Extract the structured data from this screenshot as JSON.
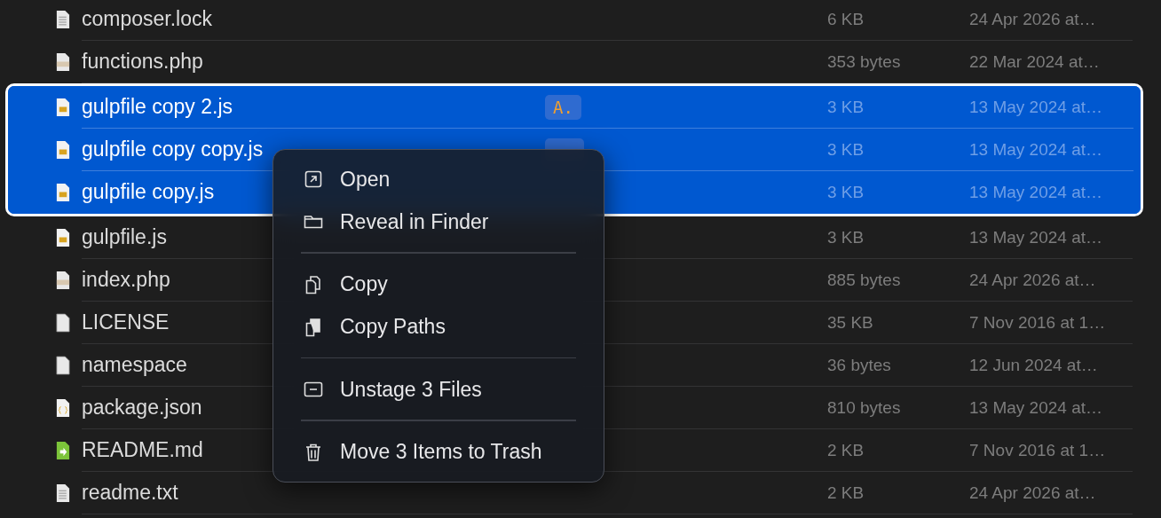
{
  "files": [
    {
      "name": "composer.lock",
      "kind": "doc",
      "size": "6 KB",
      "modified": "24 Apr 2026 at…",
      "selected": false
    },
    {
      "name": "functions.php",
      "kind": "php",
      "size": "353 bytes",
      "modified": "22 Mar 2024 at…",
      "selected": false
    },
    {
      "name": "gulpfile copy 2.js",
      "kind": "js",
      "badge": "A.",
      "size": "3 KB",
      "modified": "13 May 2024 at…",
      "selected": true
    },
    {
      "name": "gulpfile copy copy.js",
      "kind": "js",
      "badge_covered": true,
      "size": "3 KB",
      "modified": "13 May 2024 at…",
      "selected": true
    },
    {
      "name": "gulpfile copy.js",
      "kind": "js",
      "size": "3 KB",
      "modified": "13 May 2024 at…",
      "selected": true
    },
    {
      "name": "gulpfile.js",
      "kind": "js",
      "size": "3 KB",
      "modified": "13 May 2024 at…",
      "selected": false
    },
    {
      "name": "index.php",
      "kind": "php",
      "size": "885 bytes",
      "modified": "24 Apr 2026 at…",
      "selected": false
    },
    {
      "name": "LICENSE",
      "kind": "blank",
      "size": "35 KB",
      "modified": "7 Nov 2016 at 1…",
      "selected": false
    },
    {
      "name": "namespace",
      "kind": "blank",
      "size": "36 bytes",
      "modified": "12 Jun 2024 at…",
      "selected": false
    },
    {
      "name": "package.json",
      "kind": "json",
      "size": "810 bytes",
      "modified": "13 May 2024 at…",
      "selected": false
    },
    {
      "name": "README.md",
      "kind": "md",
      "size": "2 KB",
      "modified": "7 Nov 2016 at 1…",
      "selected": false
    },
    {
      "name": "readme.txt",
      "kind": "txt",
      "size": "2 KB",
      "modified": "24 Apr 2026 at…",
      "selected": false
    }
  ],
  "context_menu": {
    "sections": [
      [
        {
          "label": "Open",
          "kind": "open"
        },
        {
          "label": "Reveal in Finder",
          "kind": "folder"
        }
      ],
      [
        {
          "label": "Copy",
          "kind": "copy"
        },
        {
          "label": "Copy Paths",
          "kind": "copy-paths"
        }
      ],
      [
        {
          "label": "Unstage 3 Files",
          "kind": "unstage"
        }
      ],
      [
        {
          "label": "Move 3 Items to Trash",
          "kind": "trash"
        }
      ]
    ]
  }
}
